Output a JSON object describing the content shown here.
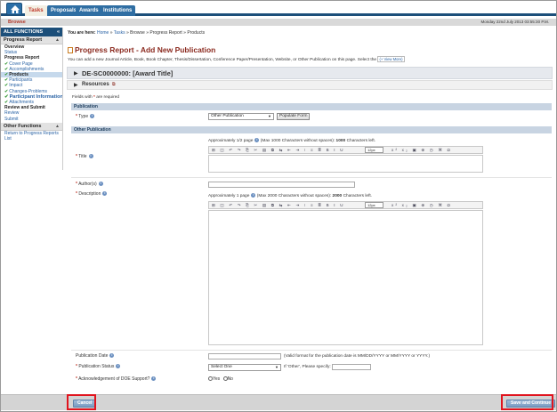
{
  "tabs": [
    "Tasks",
    "Proposals",
    "Awards",
    "Institutions"
  ],
  "subnav": {
    "label": "Browse",
    "datetime": "Monday 22nd July 2013 03:55:30 P.M."
  },
  "sidebar": {
    "header": "ALL FUNCTIONS",
    "collapse": "«",
    "section1": "Progress Report",
    "items1": [
      {
        "label": "Overview",
        "style": "bold",
        "check": false
      },
      {
        "label": "Status",
        "style": "link",
        "check": false
      },
      {
        "label": "Progress Report",
        "style": "bold",
        "check": false
      },
      {
        "label": "Cover Page",
        "style": "link",
        "check": true
      },
      {
        "label": "Accomplishments",
        "style": "link",
        "check": true
      },
      {
        "label": "Products",
        "style": "sel",
        "check": true
      },
      {
        "label": "Participants",
        "style": "link",
        "check": true
      },
      {
        "label": "Impact",
        "style": "link",
        "check": true
      },
      {
        "label": "Changes-Problems",
        "style": "link",
        "check": true
      },
      {
        "label": "Participant Information",
        "style": "big",
        "check": true
      },
      {
        "label": "Attachments",
        "style": "link",
        "check": true
      },
      {
        "label": "Review and Submit",
        "style": "bold",
        "check": false
      },
      {
        "label": "Review",
        "style": "link",
        "check": false
      },
      {
        "label": "Submit",
        "style": "link",
        "check": false
      }
    ],
    "section2": "Other Functions",
    "items2": [
      {
        "label": "Return to Progress Reports",
        "style": "link",
        "check": false
      },
      {
        "label": "List",
        "style": "link",
        "check": false
      }
    ]
  },
  "breadcrumb": {
    "prefix": "You are here:",
    "path": [
      {
        "label": "Home",
        "link": true
      },
      {
        "label": "Tasks",
        "link": true
      },
      {
        "label": "Browse",
        "link": false
      },
      {
        "label": "Progress Report",
        "link": false
      },
      {
        "label": "Products",
        "link": false
      }
    ]
  },
  "page": {
    "title": "Progress Report - Add New Publication",
    "intro": "You can add a new Journal Article, Book, Book Chapter, Thesis/Dissertation, Conference Paper/Presentation, Website, or Other Publication on this page. Select the",
    "view_more": "(+ View More)",
    "award": "DE-SC0000000: [Award Title]",
    "resources": "Resources",
    "required_note_pre": "Fields with",
    "required_note_post": "are required"
  },
  "form": {
    "section_publication": "Publication",
    "type_label": "Type",
    "type_value": "Other Publication",
    "populate_btn": "Populate Form",
    "section_other": "Other Publication",
    "title_hint": "Approximately 1/2 page",
    "title_hint2": "(Max 1000 Characters without spaces):",
    "title_count": "1000",
    "title_hint3": "Characters left.",
    "title_label": "Title",
    "authors_label": "Author(s)",
    "desc_label": "Description",
    "desc_hint": "Approximately 1 page",
    "desc_hint2": "(Max 2000 Characters without spaces):",
    "desc_count": "2000",
    "desc_hint3": "Characters left.",
    "pubdate_label": "Publication Date",
    "pubdate_hint": "(Valid format for the publication date is MM/DD/YYYY or MM/YYYY or YYYY.)",
    "status_label": "Publication Status",
    "status_value": "Select One",
    "status_other": "If 'Other', Please specify:",
    "doe_label": "Acknowledgement of DOE Support?",
    "yes": "Yes",
    "no": "No",
    "font_size": "12px"
  },
  "buttons": {
    "cancel": "Cancel",
    "save": "Save and Continue"
  },
  "colors": {
    "brand": "#1c4f7a",
    "title": "#8b2a1f",
    "highlight": "#e0141e"
  }
}
